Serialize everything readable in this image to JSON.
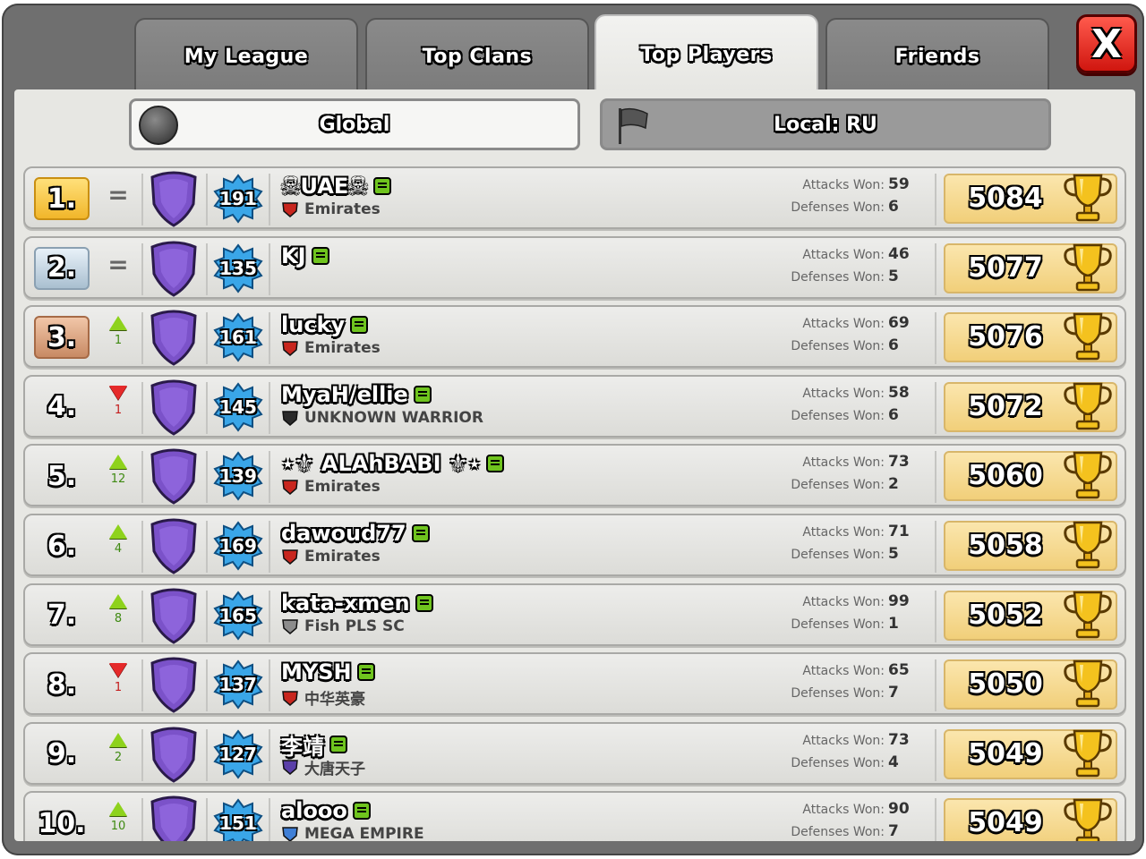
{
  "tabs": [
    {
      "label": "My League",
      "active": false
    },
    {
      "label": "Top Clans",
      "active": false
    },
    {
      "label": "Top Players",
      "active": true
    },
    {
      "label": "Friends",
      "active": false
    }
  ],
  "close_label": "X",
  "filters": {
    "global": "Global",
    "local": "Local: RU"
  },
  "stats_labels": {
    "attacks": "Attacks Won:",
    "defenses": "Defenses Won:"
  },
  "players": [
    {
      "rank": "1.",
      "trend": "same",
      "change": "",
      "level": "191",
      "name": "☠UAE☠",
      "clan": "Emirates",
      "clan_icon": "red-shield",
      "attacks": "59",
      "defenses": "6",
      "trophies": "5084"
    },
    {
      "rank": "2.",
      "trend": "same",
      "change": "",
      "level": "135",
      "name": "KJ",
      "clan": "",
      "clan_icon": "",
      "attacks": "46",
      "defenses": "5",
      "trophies": "5077"
    },
    {
      "rank": "3.",
      "trend": "up",
      "change": "1",
      "level": "161",
      "name": "lucky",
      "clan": "Emirates",
      "clan_icon": "red-shield",
      "attacks": "69",
      "defenses": "6",
      "trophies": "5076"
    },
    {
      "rank": "4.",
      "trend": "down",
      "change": "1",
      "level": "145",
      "name": "MyaH/ellie",
      "clan": "UNKNOWN WARRIOR",
      "clan_icon": "black-shield",
      "attacks": "58",
      "defenses": "6",
      "trophies": "5072"
    },
    {
      "rank": "5.",
      "trend": "up",
      "change": "12",
      "level": "139",
      "name": "⋆⚜ ALAhBABI ⚜⋆",
      "clan": "Emirates",
      "clan_icon": "red-shield",
      "attacks": "73",
      "defenses": "2",
      "trophies": "5060"
    },
    {
      "rank": "6.",
      "trend": "up",
      "change": "4",
      "level": "169",
      "name": "dawoud77",
      "clan": "Emirates",
      "clan_icon": "red-shield",
      "attacks": "71",
      "defenses": "5",
      "trophies": "5058"
    },
    {
      "rank": "7.",
      "trend": "up",
      "change": "8",
      "level": "165",
      "name": "kata-xmen",
      "clan": "Fish PLS SC",
      "clan_icon": "grey-shield",
      "attacks": "99",
      "defenses": "1",
      "trophies": "5052"
    },
    {
      "rank": "8.",
      "trend": "down",
      "change": "1",
      "level": "137",
      "name": "MYSH",
      "clan": "中华英豪",
      "clan_icon": "red-shield",
      "attacks": "65",
      "defenses": "7",
      "trophies": "5050"
    },
    {
      "rank": "9.",
      "trend": "up",
      "change": "2",
      "level": "127",
      "name": "李靖",
      "clan": "大唐天子",
      "clan_icon": "purple-shield",
      "attacks": "73",
      "defenses": "4",
      "trophies": "5049"
    },
    {
      "rank": "10.",
      "trend": "up",
      "change": "10",
      "level": "151",
      "name": "alooo",
      "clan": "MEGA EMPIRE",
      "clan_icon": "blue-shield",
      "attacks": "90",
      "defenses": "7",
      "trophies": "5049"
    }
  ],
  "colors": {
    "gold": "#f1b62a",
    "silver": "#a9bfd0",
    "bronze": "#c88a64",
    "up": "#8ed21c",
    "down": "#e52a2a",
    "league": "#7b52c9",
    "level_badge": "#3aa6e8"
  }
}
